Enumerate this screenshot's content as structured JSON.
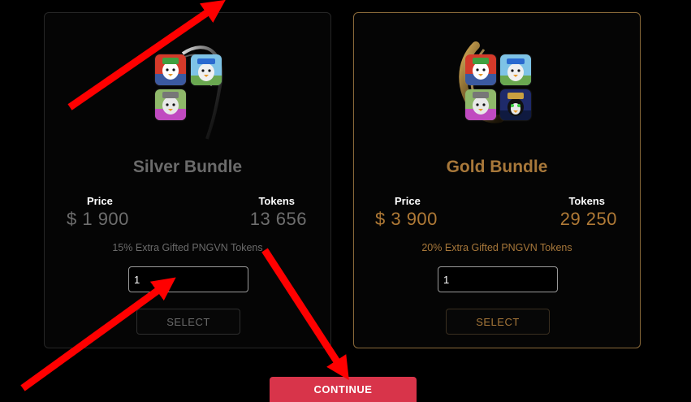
{
  "bundles": {
    "silver": {
      "title": "Silver Bundle",
      "price_label": "Price",
      "price_value": "$ 1 900",
      "tokens_label": "Tokens",
      "tokens_value": "13 656",
      "extra_text": "15% Extra Gifted PNGVN Tokens",
      "quantity_value": "1",
      "select_label": "SELECT"
    },
    "gold": {
      "title": "Gold Bundle",
      "price_label": "Price",
      "price_value": "$ 3 900",
      "tokens_label": "Tokens",
      "tokens_value": "29 250",
      "extra_text": "20% Extra Gifted PNGVN Tokens",
      "quantity_value": "1",
      "select_label": "SELECT"
    }
  },
  "continue_label": "CONTINUE",
  "colors": {
    "silver_accent": "#6b6b6b",
    "gold_accent": "#a8783a",
    "continue_button": "#d8344a",
    "annotation_arrow": "#ff0000"
  },
  "icons": {
    "nft_avatar": "penguin-character-icon",
    "annotation": "red-arrow-icon"
  }
}
